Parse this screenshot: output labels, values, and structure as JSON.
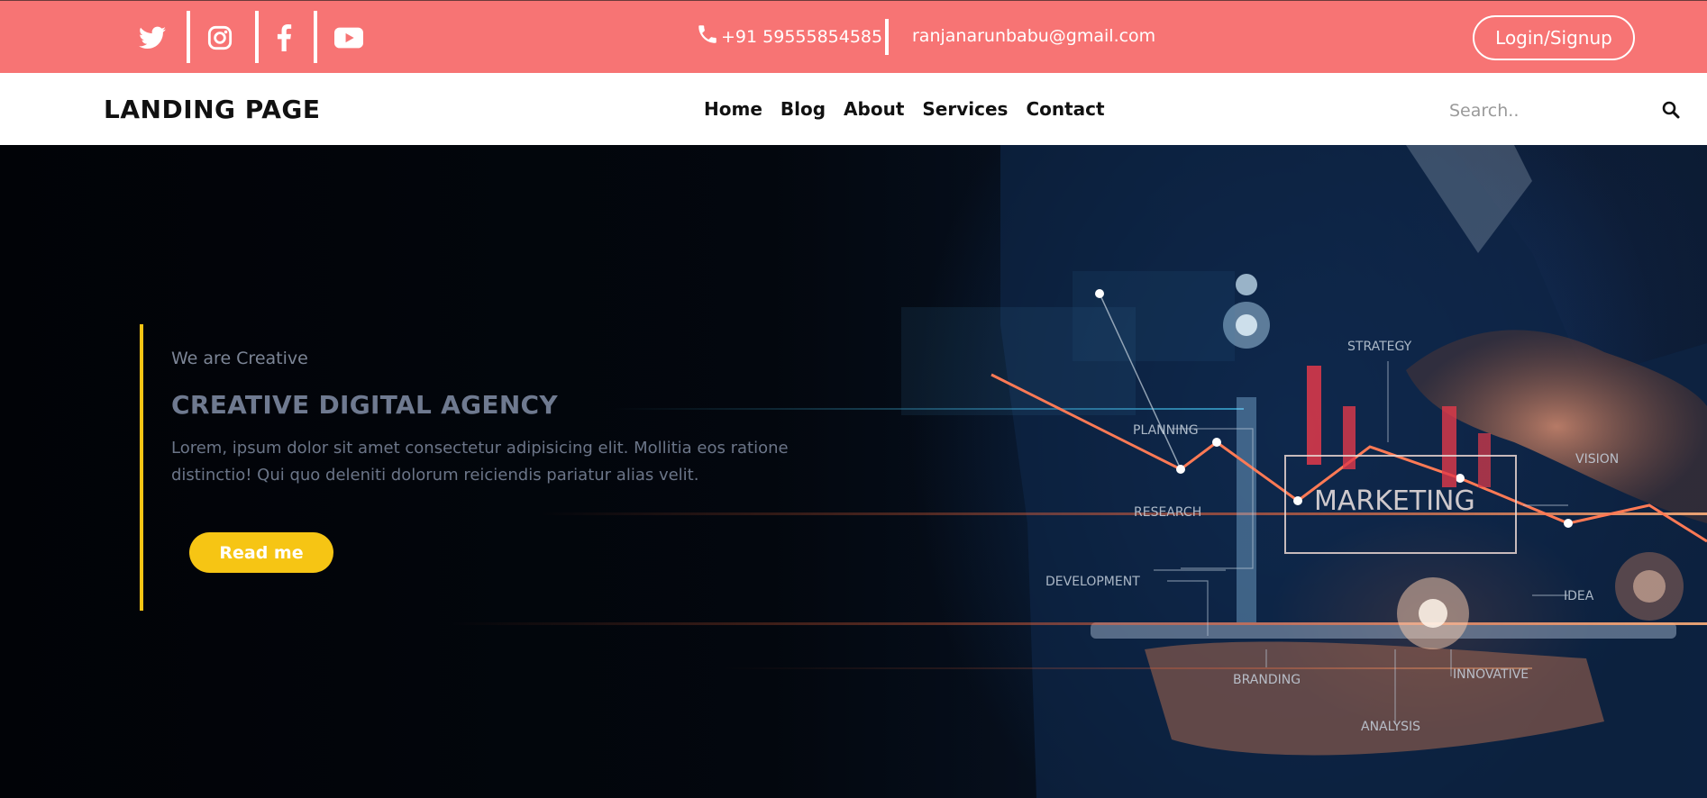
{
  "topbar": {
    "social": [
      "twitter-icon",
      "instagram-icon",
      "facebook-icon",
      "youtube-icon"
    ],
    "phone": "+91 59555854585",
    "email": "ranjanarunbabu@gmail.com",
    "login_label": "Login/Signup",
    "background_color": "#f77474"
  },
  "navbar": {
    "brand": "LANDING PAGE",
    "links": [
      "Home",
      "Blog",
      "About",
      "Services",
      "Contact"
    ],
    "search_placeholder": "Search.."
  },
  "hero": {
    "tagline": "We are Creative",
    "title": "CREATIVE DIGITAL AGENCY",
    "text": "Lorem, ipsum dolor sit amet consectetur adipisicing elit. Mollitia eos ratione distinctio! Qui quo deleniti dolorum reiciendis pariatur alias velit.",
    "button_label": "Read me",
    "accent_color": "#f6c514",
    "image_labels": {
      "strategy": "STRATEGY",
      "planning": "PLANNING",
      "research": "RESEARCH",
      "marketing": "MARKETING",
      "vision": "VISION",
      "development": "DEVELOPMENT",
      "idea": "IDEA",
      "branding": "BRANDING",
      "innovative": "INNOVATIVE",
      "analysis": "ANALYSIS"
    }
  }
}
